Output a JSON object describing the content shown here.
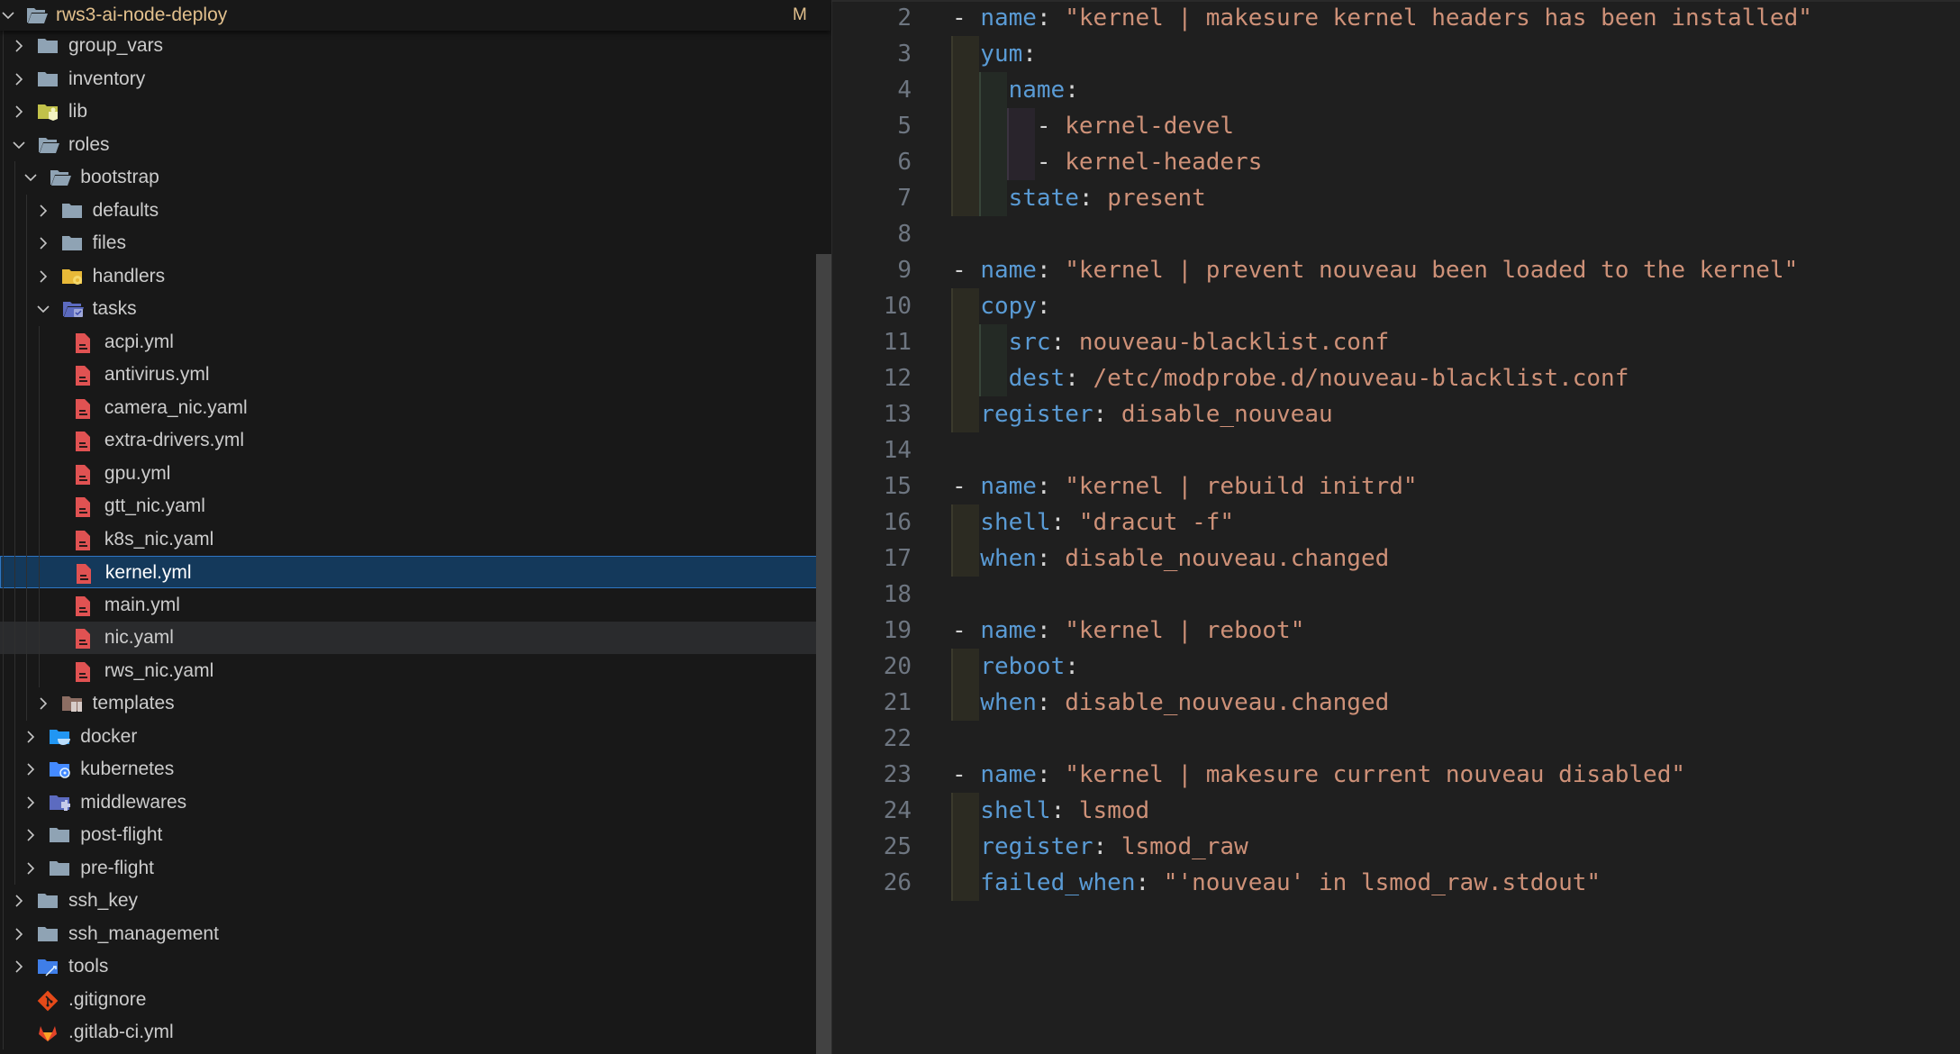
{
  "explorer": {
    "root": {
      "label": "rws3-ai-node-deploy",
      "badge": "M",
      "expanded": true
    },
    "items": [
      {
        "label": "group_vars",
        "level": 1,
        "type": "folder",
        "icon": "folder-icon",
        "expanded": false
      },
      {
        "label": "inventory",
        "level": 1,
        "type": "folder",
        "icon": "folder-icon",
        "expanded": false
      },
      {
        "label": "lib",
        "level": 1,
        "type": "folder",
        "icon": "lib-folder-icon",
        "expanded": false
      },
      {
        "label": "roles",
        "level": 1,
        "type": "folder",
        "icon": "folder-open-icon",
        "expanded": true
      },
      {
        "label": "bootstrap",
        "level": 2,
        "type": "folder",
        "icon": "folder-open-icon",
        "expanded": true
      },
      {
        "label": "defaults",
        "level": 3,
        "type": "folder",
        "icon": "folder-icon",
        "expanded": false
      },
      {
        "label": "files",
        "level": 3,
        "type": "folder",
        "icon": "folder-icon",
        "expanded": false
      },
      {
        "label": "handlers",
        "level": 3,
        "type": "folder",
        "icon": "handlers-folder-icon",
        "expanded": false
      },
      {
        "label": "tasks",
        "level": 3,
        "type": "folder",
        "icon": "tasks-folder-icon",
        "expanded": true
      },
      {
        "label": "acpi.yml",
        "level": 4,
        "type": "file",
        "icon": "yaml-file-icon"
      },
      {
        "label": "antivirus.yml",
        "level": 4,
        "type": "file",
        "icon": "yaml-file-icon"
      },
      {
        "label": "camera_nic.yaml",
        "level": 4,
        "type": "file",
        "icon": "yaml-file-icon"
      },
      {
        "label": "extra-drivers.yml",
        "level": 4,
        "type": "file",
        "icon": "yaml-file-icon"
      },
      {
        "label": "gpu.yml",
        "level": 4,
        "type": "file",
        "icon": "yaml-file-icon"
      },
      {
        "label": "gtt_nic.yaml",
        "level": 4,
        "type": "file",
        "icon": "yaml-file-icon"
      },
      {
        "label": "k8s_nic.yaml",
        "level": 4,
        "type": "file",
        "icon": "yaml-file-icon"
      },
      {
        "label": "kernel.yml",
        "level": 4,
        "type": "file",
        "icon": "yaml-file-icon",
        "selected": true
      },
      {
        "label": "main.yml",
        "level": 4,
        "type": "file",
        "icon": "yaml-file-icon"
      },
      {
        "label": "nic.yaml",
        "level": 4,
        "type": "file",
        "icon": "yaml-file-icon",
        "hovered": true
      },
      {
        "label": "rws_nic.yaml",
        "level": 4,
        "type": "file",
        "icon": "yaml-file-icon"
      },
      {
        "label": "templates",
        "level": 3,
        "type": "folder",
        "icon": "templates-folder-icon",
        "expanded": false
      },
      {
        "label": "docker",
        "level": 2,
        "type": "folder",
        "icon": "docker-folder-icon",
        "expanded": false
      },
      {
        "label": "kubernetes",
        "level": 2,
        "type": "folder",
        "icon": "kubernetes-folder-icon",
        "expanded": false
      },
      {
        "label": "middlewares",
        "level": 2,
        "type": "folder",
        "icon": "middlewares-folder-icon",
        "expanded": false
      },
      {
        "label": "post-flight",
        "level": 2,
        "type": "folder",
        "icon": "folder-icon",
        "expanded": false
      },
      {
        "label": "pre-flight",
        "level": 2,
        "type": "folder",
        "icon": "folder-icon",
        "expanded": false
      },
      {
        "label": "ssh_key",
        "level": 1,
        "type": "folder",
        "icon": "folder-icon",
        "expanded": false
      },
      {
        "label": "ssh_management",
        "level": 1,
        "type": "folder",
        "icon": "folder-icon",
        "expanded": false
      },
      {
        "label": "tools",
        "level": 1,
        "type": "folder",
        "icon": "tools-folder-icon",
        "expanded": false
      },
      {
        "label": ".gitignore",
        "level": 1,
        "type": "file",
        "icon": "git-icon"
      },
      {
        "label": ".gitlab-ci.yml",
        "level": 1,
        "type": "file",
        "icon": "gitlab-icon"
      }
    ]
  },
  "editor": {
    "file": "kernel.yml",
    "lines": [
      {
        "n": "2",
        "indent": 0,
        "tokens": [
          [
            "p",
            "- "
          ],
          [
            "k",
            "name"
          ],
          [
            "p",
            ": "
          ],
          [
            "s",
            "\"kernel | makesure kernel headers has been installed\""
          ]
        ]
      },
      {
        "n": "3",
        "indent": 1,
        "tokens": [
          [
            "k",
            "yum"
          ],
          [
            "p",
            ":"
          ]
        ]
      },
      {
        "n": "4",
        "indent": 2,
        "tokens": [
          [
            "k",
            "name"
          ],
          [
            "p",
            ":"
          ]
        ]
      },
      {
        "n": "5",
        "indent": 3,
        "tokens": [
          [
            "p",
            "- "
          ],
          [
            "s",
            "kernel-devel"
          ]
        ]
      },
      {
        "n": "6",
        "indent": 3,
        "tokens": [
          [
            "p",
            "- "
          ],
          [
            "s",
            "kernel-headers"
          ]
        ]
      },
      {
        "n": "7",
        "indent": 2,
        "tokens": [
          [
            "k",
            "state"
          ],
          [
            "p",
            ": "
          ],
          [
            "s",
            "present"
          ]
        ]
      },
      {
        "n": "8",
        "indent": 0,
        "tokens": []
      },
      {
        "n": "9",
        "indent": 0,
        "tokens": [
          [
            "p",
            "- "
          ],
          [
            "k",
            "name"
          ],
          [
            "p",
            ": "
          ],
          [
            "s",
            "\"kernel | prevent nouveau been loaded to the kernel\""
          ]
        ]
      },
      {
        "n": "10",
        "indent": 1,
        "tokens": [
          [
            "k",
            "copy"
          ],
          [
            "p",
            ":"
          ]
        ]
      },
      {
        "n": "11",
        "indent": 2,
        "tokens": [
          [
            "k",
            "src"
          ],
          [
            "p",
            ": "
          ],
          [
            "s",
            "nouveau-blacklist.conf"
          ]
        ]
      },
      {
        "n": "12",
        "indent": 2,
        "tokens": [
          [
            "k",
            "dest"
          ],
          [
            "p",
            ": "
          ],
          [
            "s",
            "/etc/modprobe.d/nouveau-blacklist.conf"
          ]
        ]
      },
      {
        "n": "13",
        "indent": 1,
        "tokens": [
          [
            "k",
            "register"
          ],
          [
            "p",
            ": "
          ],
          [
            "s",
            "disable_nouveau"
          ]
        ]
      },
      {
        "n": "14",
        "indent": 0,
        "tokens": []
      },
      {
        "n": "15",
        "indent": 0,
        "tokens": [
          [
            "p",
            "- "
          ],
          [
            "k",
            "name"
          ],
          [
            "p",
            ": "
          ],
          [
            "s",
            "\"kernel | rebuild initrd\""
          ]
        ]
      },
      {
        "n": "16",
        "indent": 1,
        "tokens": [
          [
            "k",
            "shell"
          ],
          [
            "p",
            ": "
          ],
          [
            "s",
            "\"dracut -f\""
          ]
        ]
      },
      {
        "n": "17",
        "indent": 1,
        "tokens": [
          [
            "k",
            "when"
          ],
          [
            "p",
            ": "
          ],
          [
            "s",
            "disable_nouveau.changed"
          ]
        ]
      },
      {
        "n": "18",
        "indent": 0,
        "tokens": []
      },
      {
        "n": "19",
        "indent": 0,
        "tokens": [
          [
            "p",
            "- "
          ],
          [
            "k",
            "name"
          ],
          [
            "p",
            ": "
          ],
          [
            "s",
            "\"kernel | reboot\""
          ]
        ]
      },
      {
        "n": "20",
        "indent": 1,
        "tokens": [
          [
            "k",
            "reboot"
          ],
          [
            "p",
            ":"
          ]
        ]
      },
      {
        "n": "21",
        "indent": 1,
        "tokens": [
          [
            "k",
            "when"
          ],
          [
            "p",
            ": "
          ],
          [
            "s",
            "disable_nouveau.changed"
          ]
        ]
      },
      {
        "n": "22",
        "indent": 0,
        "tokens": []
      },
      {
        "n": "23",
        "indent": 0,
        "tokens": [
          [
            "p",
            "- "
          ],
          [
            "k",
            "name"
          ],
          [
            "p",
            ": "
          ],
          [
            "s",
            "\"kernel | makesure current nouveau disabled\""
          ]
        ]
      },
      {
        "n": "24",
        "indent": 1,
        "tokens": [
          [
            "k",
            "shell"
          ],
          [
            "p",
            ": "
          ],
          [
            "s",
            "lsmod"
          ]
        ]
      },
      {
        "n": "25",
        "indent": 1,
        "tokens": [
          [
            "k",
            "register"
          ],
          [
            "p",
            ": "
          ],
          [
            "s",
            "lsmod_raw"
          ]
        ]
      },
      {
        "n": "26",
        "indent": 1,
        "tokens": [
          [
            "k",
            "failed_when"
          ],
          [
            "p",
            ": "
          ],
          [
            "s",
            "\"'nouveau' in lsmod_raw.stdout\""
          ]
        ]
      }
    ]
  },
  "colors": {
    "yaml_key": "#5a9bd5",
    "yaml_string": "#ce9178",
    "modified": "#e2c08d",
    "selection_bg": "#14395b",
    "selection_border": "#2f76c2"
  }
}
